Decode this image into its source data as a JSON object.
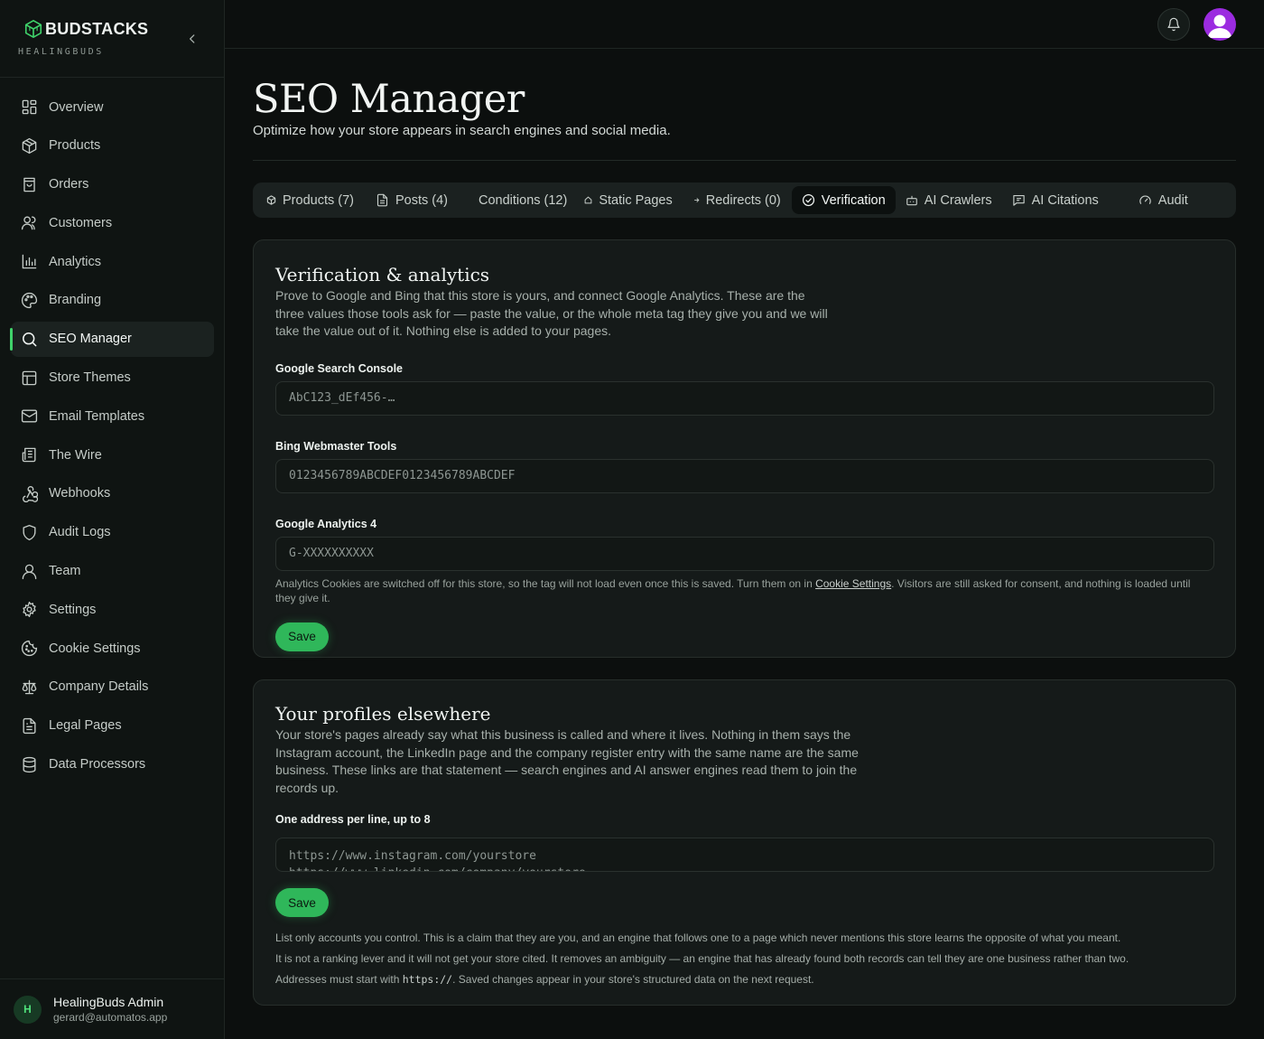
{
  "brand": {
    "name": "BUDSTACKS",
    "sub": "HEALINGBUDS"
  },
  "sidebar": {
    "items": [
      {
        "label": "Overview",
        "icon": "grid-icon"
      },
      {
        "label": "Products",
        "icon": "box-icon"
      },
      {
        "label": "Orders",
        "icon": "shopping-bag-icon"
      },
      {
        "label": "Customers",
        "icon": "users-icon"
      },
      {
        "label": "Analytics",
        "icon": "bar-chart-icon"
      },
      {
        "label": "Branding",
        "icon": "palette-icon"
      },
      {
        "label": "SEO Manager",
        "icon": "search-icon",
        "active": true
      },
      {
        "label": "Store Themes",
        "icon": "layout-icon"
      },
      {
        "label": "Email Templates",
        "icon": "mail-icon"
      },
      {
        "label": "The Wire",
        "icon": "newspaper-icon"
      },
      {
        "label": "Webhooks",
        "icon": "webhook-icon"
      },
      {
        "label": "Audit Logs",
        "icon": "shield-icon"
      },
      {
        "label": "Team",
        "icon": "user-icon"
      },
      {
        "label": "Settings",
        "icon": "gear-icon"
      },
      {
        "label": "Cookie Settings",
        "icon": "cookie-icon"
      },
      {
        "label": "Company Details",
        "icon": "scale-icon"
      },
      {
        "label": "Legal Pages",
        "icon": "file-text-icon"
      },
      {
        "label": "Data Processors",
        "icon": "database-icon"
      }
    ]
  },
  "user": {
    "initial": "H",
    "name": "HealingBuds Admin",
    "email": "gerard@automatos.app"
  },
  "page": {
    "title": "SEO Manager",
    "subtitle": "Optimize how your store appears in search engines and social media."
  },
  "tabs": [
    {
      "label": "Products (7)",
      "icon": "box-icon"
    },
    {
      "label": "Posts (4)",
      "icon": "file-icon"
    },
    {
      "label": "Conditions (12)",
      "icon": ""
    },
    {
      "label": "Static Pages",
      "icon": "home-icon"
    },
    {
      "label": "Redirects (0)",
      "icon": "arrow-icon"
    },
    {
      "label": "Verification",
      "icon": "check-circle-icon",
      "active": true
    },
    {
      "label": "AI Crawlers",
      "icon": "bot-icon"
    },
    {
      "label": "AI Citations",
      "icon": "message-icon"
    },
    {
      "label": "Audit",
      "icon": "gauge-icon"
    }
  ],
  "verification": {
    "title": "Verification & analytics",
    "description": "Prove to Google and Bing that this store is yours, and connect Google Analytics. These are the three values those tools ask for — paste the value, or the whole meta tag they give you and we will take the value out of it. Nothing else is added to your pages.",
    "gsc_label": "Google Search Console",
    "gsc_placeholder": "AbC123_dEf456-…",
    "bing_label": "Bing Webmaster Tools",
    "bing_placeholder": "0123456789ABCDEF0123456789ABCDEF",
    "ga_label": "Google Analytics 4",
    "ga_placeholder": "G-XXXXXXXXXX",
    "hint_before": "Analytics Cookies are switched off for this store, so the tag will not load even once this is saved. Turn them on in ",
    "hint_link": "Cookie Settings",
    "hint_after": ". Visitors are still asked for consent, and nothing is loaded until they give it.",
    "save_label": "Save"
  },
  "profiles": {
    "title": "Your profiles elsewhere",
    "description": "Your store's pages already say what this business is called and where it lives. Nothing in them says the Instagram account, the LinkedIn page and the company register entry with the same name are the same business. These links are that statement — search engines and AI answer engines read them to join the records up.",
    "field_label": "One address per line, up to 8",
    "placeholder_line1": "https://www.instagram.com/yourstore",
    "placeholder_line2": "https://www.linkedin.com/company/yourstore",
    "save_label": "Save",
    "note1": "List only accounts you control. This is a claim that they are you, and an engine that follows one to a page which never mentions this store learns the opposite of what you meant.",
    "note2": "It is not a ranking lever and it will not get your store cited. It removes an ambiguity — an engine that has already found both records can tell they are one business rather than two.",
    "note3_before": "Addresses must start with ",
    "note3_code": "https://",
    "note3_after": ". Saved changes appear in your store's structured data on the next request."
  },
  "colors": {
    "accent": "#2fb75a",
    "avatar": "#9b2be0"
  }
}
